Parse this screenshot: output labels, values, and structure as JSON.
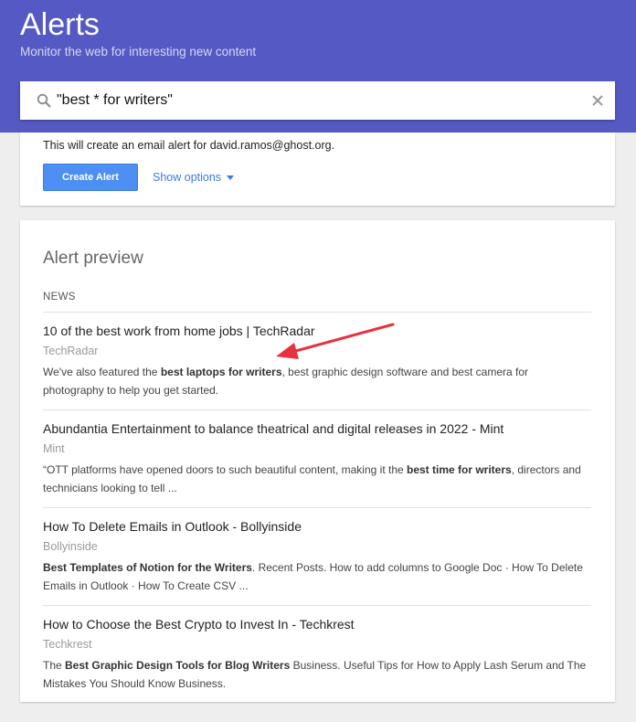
{
  "header": {
    "title": "Alerts",
    "subtitle": "Monitor the web for interesting new content"
  },
  "search": {
    "query": "\"best * for writers\"",
    "search_icon": "search-icon",
    "clear_icon": "close-icon"
  },
  "create_panel": {
    "email_note": "This will create an email alert for david.ramos@ghost.org.",
    "create_button_label": "Create Alert",
    "show_options_label": "Show options"
  },
  "preview": {
    "title": "Alert preview",
    "section_label": "NEWS",
    "results": [
      {
        "title": "10 of the best work from home jobs | TechRadar",
        "source": "TechRadar",
        "snippet_parts": [
          {
            "text": "We've also featured the ",
            "bold": false
          },
          {
            "text": "best laptops for writers",
            "bold": true
          },
          {
            "text": ", best graphic design software and best camera for photography to help you get started.",
            "bold": false
          }
        ]
      },
      {
        "title": "Abundantia Entertainment to balance theatrical and digital releases in 2022 - Mint",
        "source": "Mint",
        "snippet_parts": [
          {
            "text": "“OTT platforms have opened doors to such beautiful content, making it the ",
            "bold": false
          },
          {
            "text": "best time for writers",
            "bold": true
          },
          {
            "text": ", directors and technicians looking to tell ...",
            "bold": false
          }
        ]
      },
      {
        "title": "How To Delete Emails in Outlook - Bollyinside",
        "source": "Bollyinside",
        "snippet_parts": [
          {
            "text": "Best Templates of Notion for the Writers",
            "bold": true
          },
          {
            "text": ". Recent Posts. How to add columns to Google Doc · How To Delete Emails in Outlook · How To Create CSV ...",
            "bold": false
          }
        ]
      },
      {
        "title": "How to Choose the Best Crypto to Invest In - Techkrest",
        "source": "Techkrest",
        "snippet_parts": [
          {
            "text": "The ",
            "bold": false
          },
          {
            "text": "Best Graphic Design Tools for Blog Writers",
            "bold": true
          },
          {
            "text": " Business. Useful Tips for How to Apply Lash Serum and The Mistakes You Should Know Business.",
            "bold": false
          }
        ]
      }
    ]
  },
  "colors": {
    "header_bg": "#5559c3",
    "button_bg": "#4d8ff3",
    "link": "#3b7be0",
    "annotation_arrow": "#e8313f"
  }
}
